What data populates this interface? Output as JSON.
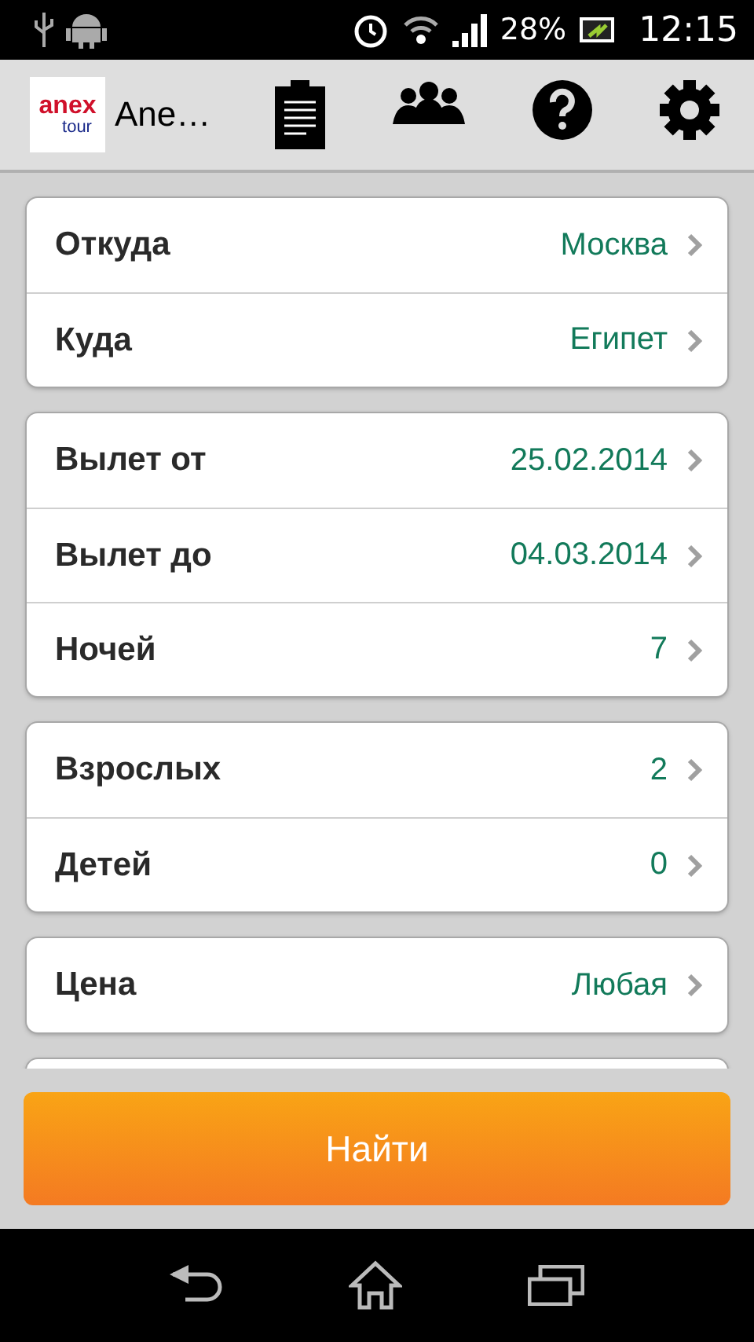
{
  "status_bar": {
    "battery": "28%",
    "time": "12:15"
  },
  "action_bar": {
    "logo_top": "anex",
    "logo_bottom": "tour",
    "title": "Ane…"
  },
  "groups": [
    [
      {
        "label": "Откуда",
        "value": "Москва"
      },
      {
        "label": "Куда",
        "value": "Египет"
      }
    ],
    [
      {
        "label": "Вылет от",
        "value": "25.02.2014"
      },
      {
        "label": "Вылет до",
        "value": "04.03.2014"
      },
      {
        "label": "Ночей",
        "value": "7"
      }
    ],
    [
      {
        "label": "Взрослых",
        "value": "2"
      },
      {
        "label": "Детей",
        "value": "0"
      }
    ],
    [
      {
        "label": "Цена",
        "value": "Любая"
      }
    ]
  ],
  "search_button": "Найти"
}
